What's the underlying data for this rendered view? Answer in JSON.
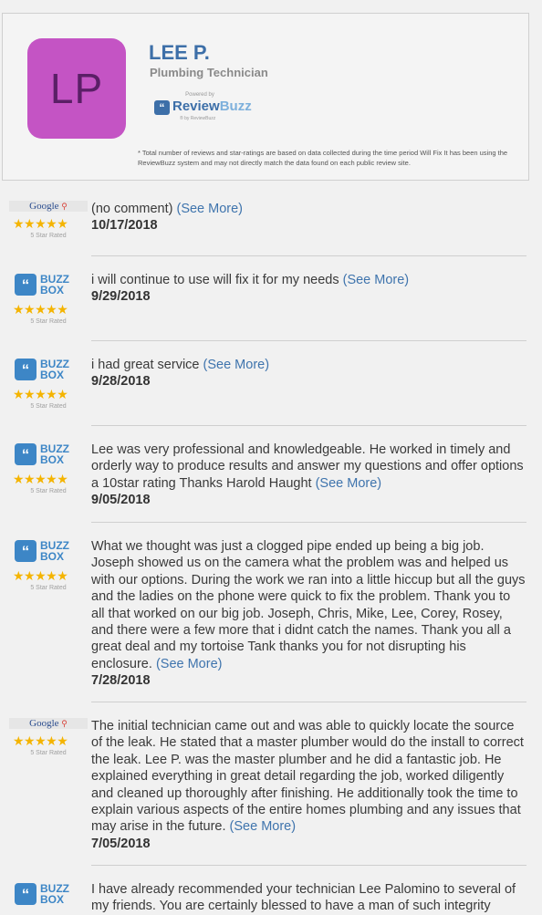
{
  "profile": {
    "initials": "LP",
    "name": "LEE P.",
    "title": "Plumbing Technician",
    "avatar_color": "#c454c4",
    "logo": {
      "powered_by": "Powered by",
      "brand_part1": "Review",
      "brand_part2": "Buzz",
      "sub": "® by ReviewBuzz"
    },
    "disclaimer": "* Total number of reviews and star-ratings are based on data collected during the time period Will Fix It has been using the ReviewBuzz system and may not directly match the data found on each public review site."
  },
  "see_more_label": "(See More)",
  "rated_label": "5 Star Rated",
  "stars": "★★★★★",
  "google_label": "Google",
  "buzz_line1": "BUZZ",
  "buzz_line2": "BOX",
  "reviews": [
    {
      "source": "google",
      "text": "(no comment)",
      "date": "10/17/2018",
      "rating": 5
    },
    {
      "source": "buzzbox",
      "text": "i will continue to use will fix it for my needs",
      "date": "9/29/2018",
      "rating": 5
    },
    {
      "source": "buzzbox",
      "text": "i had great service",
      "date": "9/28/2018",
      "rating": 5
    },
    {
      "source": "buzzbox",
      "text": "Lee was very professional and knowledgeable. He worked in timely and orderly way to produce results and answer my questions and offer options a 10star rating Thanks Harold Haught",
      "date": "9/05/2018",
      "rating": 5
    },
    {
      "source": "buzzbox",
      "text": "What we thought was just a clogged pipe ended up being a big job. Joseph showed us on the camera what the problem was and helped us with our options. During the work we ran into a little hiccup but all the guys and the ladies on the phone were quick to fix the problem. Thank you to all that worked on our big job. Joseph, Chris, Mike, Lee, Corey, Rosey, and there were a few more that i didnt catch the names. Thank you all a great deal and my tortoise Tank thanks you for not disrupting his enclosure.",
      "date": "7/28/2018",
      "rating": 5
    },
    {
      "source": "google",
      "text": "The initial technician came out and was able to quickly locate the source of the leak. He stated that a master plumber would do the install to correct the leak. Lee P. was the master plumber and he did a fantastic job. He explained everything in great detail regarding the job, worked diligently and cleaned up thoroughly after finishing. He additionally took the time to explain various aspects of the entire homes plumbing and any issues that may arise in the future.",
      "date": "7/05/2018",
      "rating": 5
    },
    {
      "source": "buzzbox",
      "text": "I have already recommended your technician Lee Palomino to several of my friends. You are certainly blessed to have a man of such integrity",
      "date": "",
      "rating": 5
    }
  ]
}
